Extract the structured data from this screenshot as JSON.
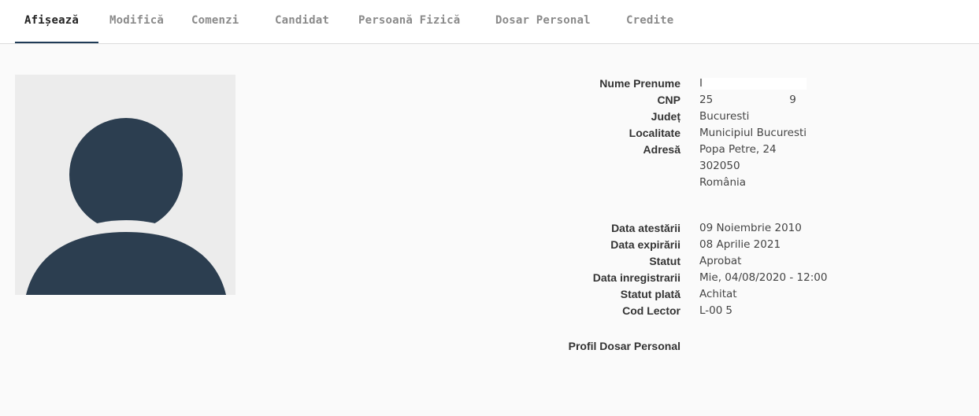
{
  "tabs": [
    {
      "label": "Afișează",
      "active": true
    },
    {
      "label": "Modifică",
      "active": false
    },
    {
      "label": "Comenzi",
      "active": false
    },
    {
      "label": "Candidat",
      "active": false
    },
    {
      "label": "Persoană Fizică",
      "active": false
    },
    {
      "label": "Dosar Personal",
      "active": false
    },
    {
      "label": "Credite",
      "active": false
    }
  ],
  "profile": {
    "avatar_icon": "user-silhouette-icon",
    "fields": {
      "nume_prenume": {
        "label": "Nume Prenume",
        "value": "I"
      },
      "cnp": {
        "label": "CNP",
        "value": "25",
        "value_end": "9"
      },
      "judet": {
        "label": "Județ",
        "value": "Bucuresti"
      },
      "localitate": {
        "label": "Localitate",
        "value": "Municipiul Bucuresti"
      },
      "adresa": {
        "label": "Adresă",
        "line1": "Popa Petre, 24",
        "line2": "302050",
        "line3": "România"
      }
    },
    "attestation": {
      "data_atestarii": {
        "label": "Data atestării",
        "value": "09 Noiembrie 2010"
      },
      "data_expirarii": {
        "label": "Data expirării",
        "value": "08 Aprilie 2021"
      },
      "statut": {
        "label": "Statut",
        "value": "Aprobat"
      },
      "data_inregistrarii": {
        "label": "Data inregistrarii",
        "value": "Mie, 04/08/2020 - 12:00"
      },
      "statut_plata": {
        "label": "Statut plată",
        "value": "Achitat"
      },
      "cod_lector": {
        "label": "Cod Lector",
        "value": "L-00",
        "value_end": "5"
      }
    },
    "profil_dosar": {
      "label": "Profil Dosar Personal"
    }
  },
  "colors": {
    "accent": "#1f3b57",
    "avatar_bg": "#ececec",
    "avatar_figure": "#2c3e50"
  }
}
